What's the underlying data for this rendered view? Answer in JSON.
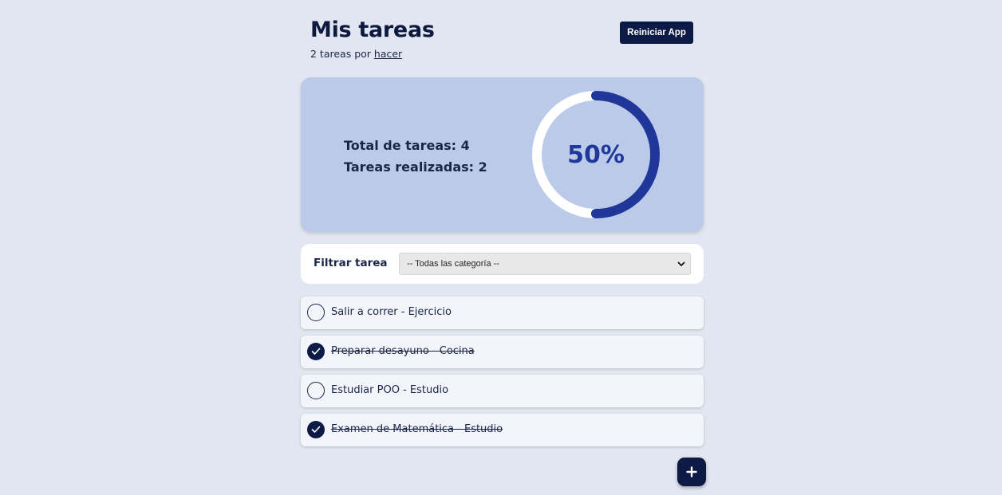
{
  "header": {
    "title": "Mis tareas",
    "subtitle_prefix": "2 tareas por",
    "subtitle_link": "hacer",
    "reset_label": "Reiniciar App"
  },
  "stats": {
    "total_text": "Total de tareas: 4",
    "done_text": "Tareas realizadas: 2",
    "progress_label": "50%",
    "progress_fraction": 0.5,
    "colors": {
      "card": "#bccaea",
      "ring_track": "#ffffff",
      "ring_fill": "#1e3799"
    }
  },
  "filter": {
    "label": "Filtrar tarea",
    "selected": "-- Todas las categoría --"
  },
  "tasks": [
    {
      "label": "Salir a correr - Ejercicio",
      "done": false
    },
    {
      "label": "Preparar desayuno - Cocina",
      "done": true
    },
    {
      "label": "Estudiar POO - Estudio",
      "done": false
    },
    {
      "label": "Examen de Matemática - Estudio",
      "done": true
    }
  ],
  "icons": {
    "check": "checkmark-icon",
    "add": "plus-icon",
    "select": "chevron-down-icon"
  },
  "colors": {
    "background": "#e1e6f0",
    "primary": "#0c1a45"
  }
}
